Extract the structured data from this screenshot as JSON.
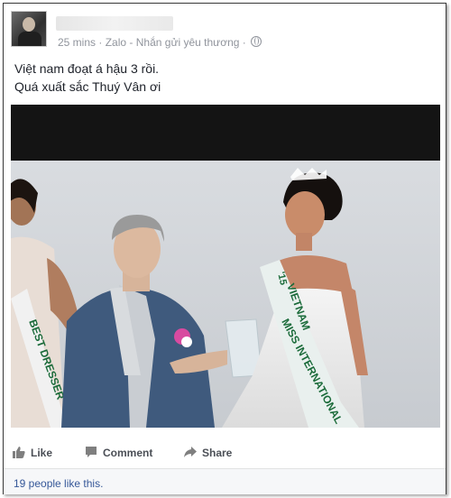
{
  "post": {
    "time": "25 mins",
    "separator": "·",
    "app": "Zalo",
    "dash": "-",
    "app_subtitle": "Nhắn gửi yêu thương",
    "separator2": "·",
    "text_line1": "Việt nam đoạt á hậu 3 rồi.",
    "text_line2": "Quá xuất sắc Thuý Vân ơi"
  },
  "photo": {
    "sash_right_text": "VIETNAM",
    "sash_right_text2": "MISS INTERNATIONAL",
    "sash_right_year": "'15",
    "sash_left_text": "BEST DRESSER"
  },
  "actions": {
    "like_label": "Like",
    "comment_label": "Comment",
    "share_label": "Share"
  },
  "likes": {
    "summary": "19 people like this."
  },
  "icons": {
    "avatar": "avatar",
    "privacy": "globe-icon",
    "like": "thumbs-up-icon",
    "comment": "comment-icon",
    "share": "share-icon"
  },
  "colors": {
    "link_blue": "#365899",
    "meta_gray": "#90949c",
    "action_gray": "#4b4f56"
  }
}
